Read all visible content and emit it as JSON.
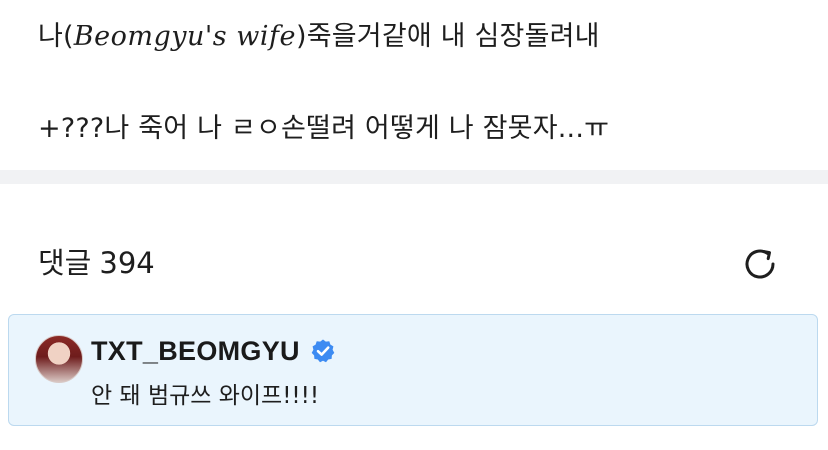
{
  "post": {
    "line1_prefix": "나(",
    "line1_math": "Beomgyu's wife",
    "line1_suffix": ")죽을거같애 내 심장돌려내",
    "line2": "+???나 죽어 나 ㄹㅇ손떨려 어떻게 나 잠못자...ㅠ"
  },
  "comments": {
    "label": "댓글",
    "count": "394",
    "refresh_icon": "refresh-icon"
  },
  "comment_items": [
    {
      "author": "TXT_BEOMGYU",
      "verified_icon": "verified-badge-icon",
      "text": "안 돼 범규쓰 와이프!!!!"
    }
  ],
  "colors": {
    "verified_blue": "#3d8bf2",
    "card_background": "#eaf5fd",
    "card_border": "#bcd9ef",
    "divider": "#f1f2f4"
  }
}
